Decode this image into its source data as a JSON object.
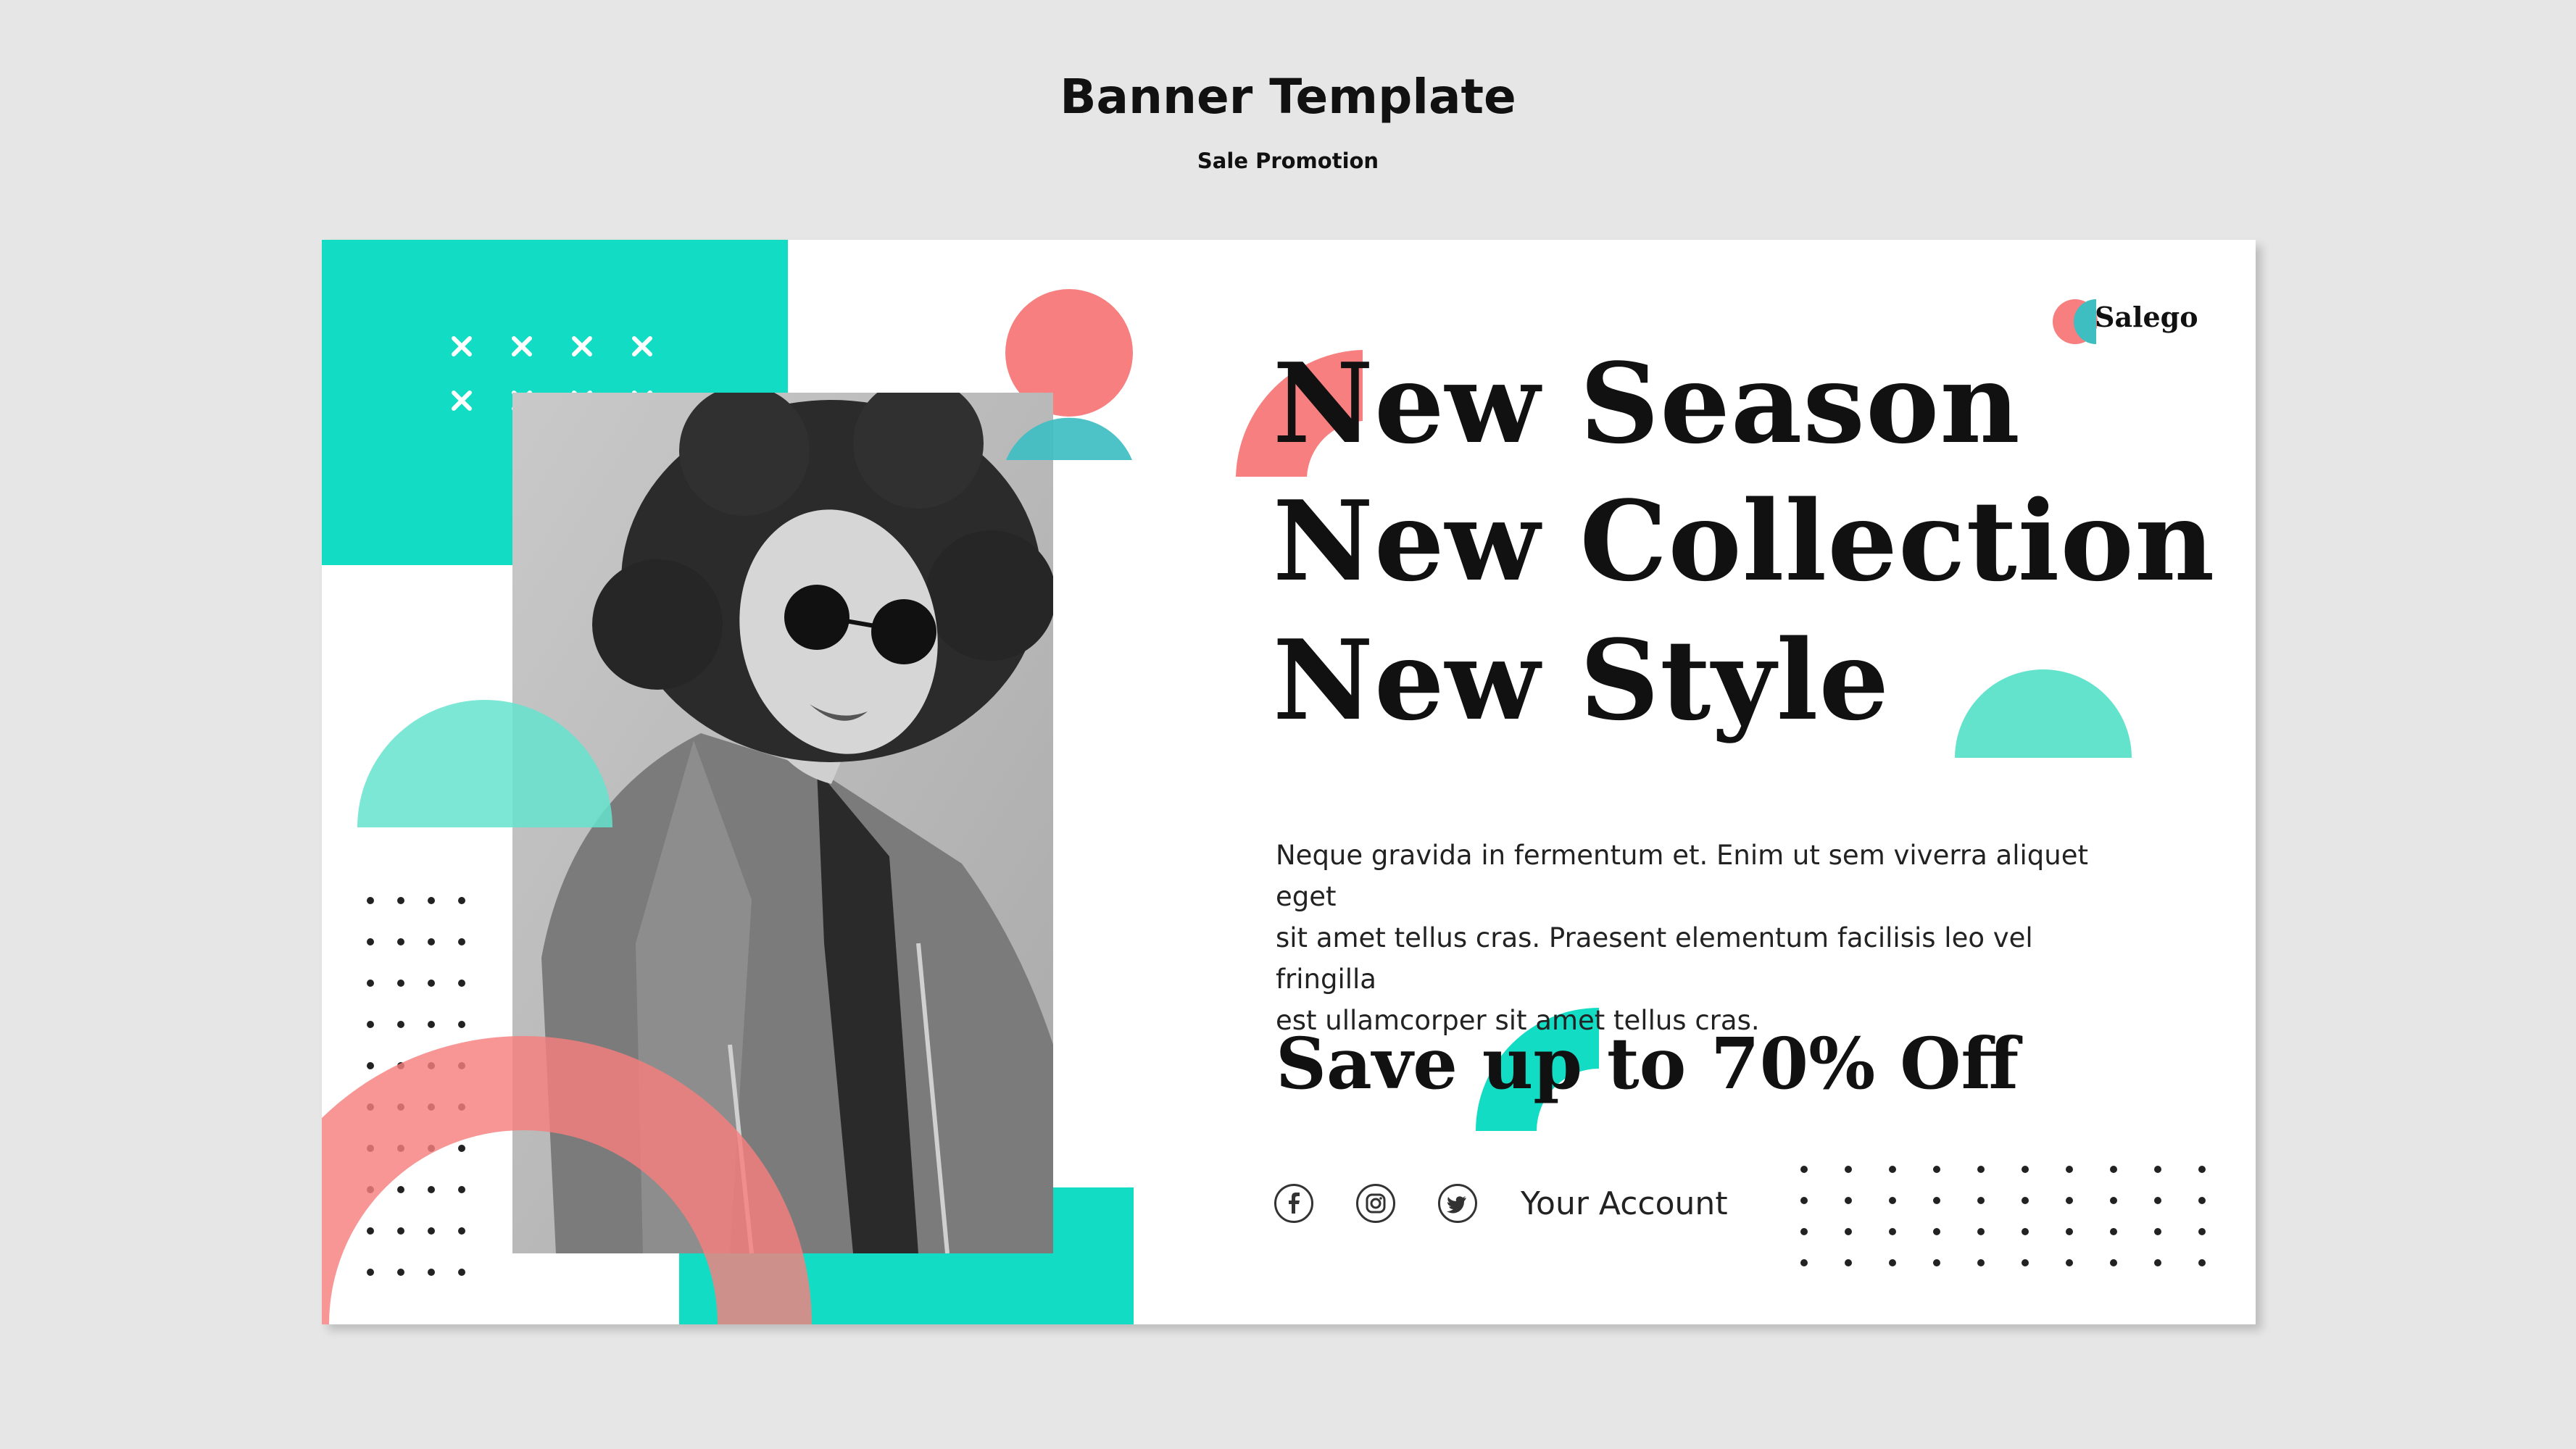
{
  "header": {
    "title": "Banner Template",
    "subtitle": "Sale Promotion"
  },
  "banner": {
    "brand": "Salego",
    "headline": [
      "New Season",
      "New Collection",
      "New Style"
    ],
    "body_lines": [
      "Neque gravida in fermentum et. Enim ut sem viverra aliquet eget",
      "sit amet tellus cras. Praesent elementum facilisis leo vel fringilla",
      "est ullamcorper sit amet tellus cras."
    ],
    "offer": "Save up to 70% Off",
    "account_label": "Your Account",
    "social_icons": [
      "facebook-icon",
      "instagram-icon",
      "twitter-icon"
    ]
  },
  "colors": {
    "page_background": "#e6e6e6",
    "banner_background": "#ffffff",
    "teal": "#12dcc4",
    "mint": "#64e3cc",
    "coral": "#f77f7f",
    "text": "#111111"
  }
}
